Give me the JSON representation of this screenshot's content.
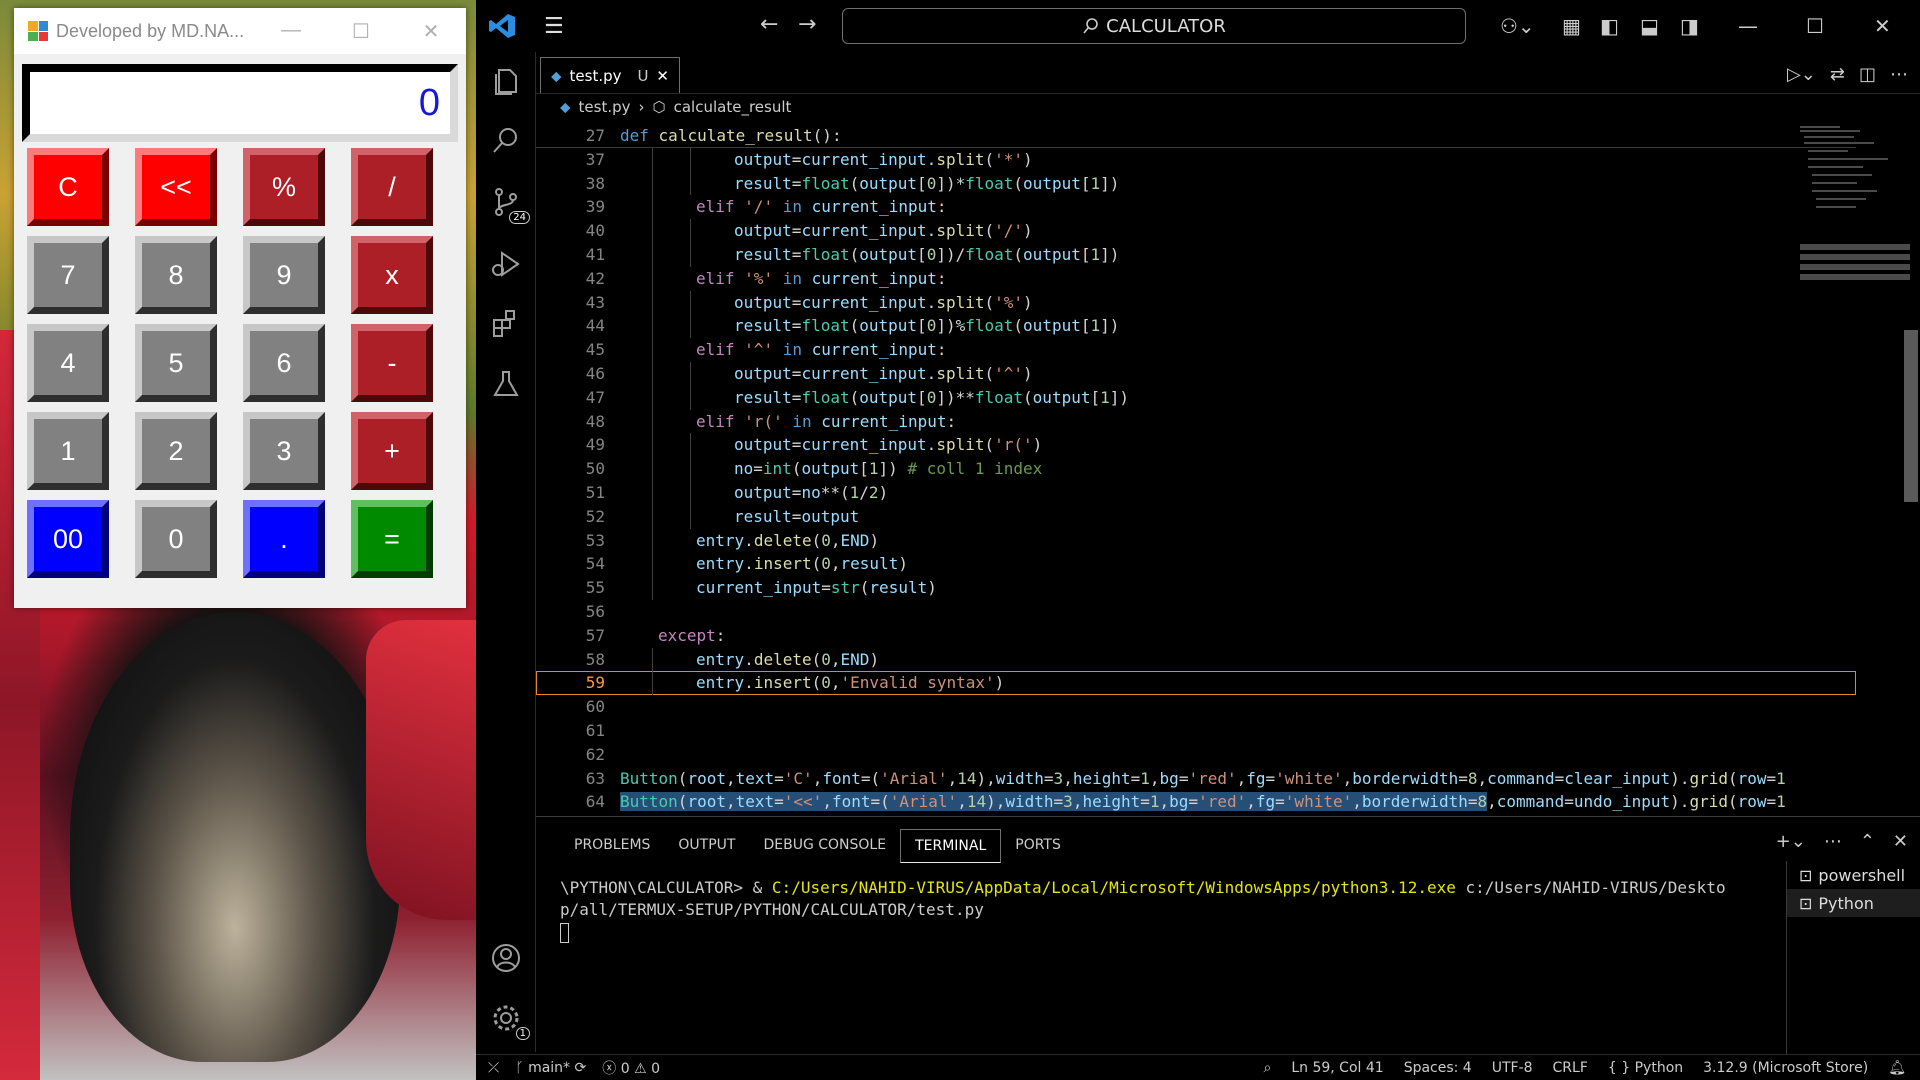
{
  "calculator": {
    "title": "Developed by MD.NA...",
    "display_value": "0",
    "buttons": [
      {
        "label": "C",
        "style": "red"
      },
      {
        "label": "<<",
        "style": "red"
      },
      {
        "label": "%",
        "style": "dred"
      },
      {
        "label": "/",
        "style": "dred"
      },
      {
        "label": "7",
        "style": "gray"
      },
      {
        "label": "8",
        "style": "gray"
      },
      {
        "label": "9",
        "style": "gray"
      },
      {
        "label": "x",
        "style": "dred"
      },
      {
        "label": "4",
        "style": "gray"
      },
      {
        "label": "5",
        "style": "gray"
      },
      {
        "label": "6",
        "style": "gray"
      },
      {
        "label": "-",
        "style": "dred"
      },
      {
        "label": "1",
        "style": "gray"
      },
      {
        "label": "2",
        "style": "gray"
      },
      {
        "label": "3",
        "style": "gray"
      },
      {
        "label": "+",
        "style": "dred"
      },
      {
        "label": "00",
        "style": "blue"
      },
      {
        "label": "0",
        "style": "gray"
      },
      {
        "label": ".",
        "style": "blue"
      },
      {
        "label": "=",
        "style": "green"
      }
    ]
  },
  "vscode": {
    "search_text": "CALCULATOR",
    "source_control_badge": "24",
    "settings_badge": "1",
    "tab": {
      "label": "test.py",
      "status": "U"
    },
    "breadcrumb": {
      "file": "test.py",
      "symbol": "calculate_result"
    },
    "code_lines": [
      {
        "n": "27",
        "html": "<span class=\"kd\">def</span> <span class=\"f\">calculate_result</span>():",
        "indent": 0,
        "sticky": true
      },
      {
        "n": "37",
        "html": "<span class=\"v\">output</span>=<span class=\"v\">current_input</span>.<span class=\"f\">split</span>(<span class=\"s\">'*'</span>)",
        "indent": 3
      },
      {
        "n": "38",
        "html": "<span class=\"v\">result</span>=<span class=\"b\">float</span>(<span class=\"v\">output</span>[<span class=\"n\">0</span>])*<span class=\"b\">float</span>(<span class=\"v\">output</span>[<span class=\"n\">1</span>])",
        "indent": 3
      },
      {
        "n": "39",
        "html": "<span class=\"k\">elif</span> <span class=\"s\">'/'</span> <span class=\"kd\">in</span> <span class=\"v\">current_input</span>:",
        "indent": 2
      },
      {
        "n": "40",
        "html": "<span class=\"v\">output</span>=<span class=\"v\">current_input</span>.<span class=\"f\">split</span>(<span class=\"s\">'/'</span>)",
        "indent": 3
      },
      {
        "n": "41",
        "html": "<span class=\"v\">result</span>=<span class=\"b\">float</span>(<span class=\"v\">output</span>[<span class=\"n\">0</span>])/<span class=\"b\">float</span>(<span class=\"v\">output</span>[<span class=\"n\">1</span>])",
        "indent": 3
      },
      {
        "n": "42",
        "html": "<span class=\"k\">elif</span> <span class=\"s\">'%'</span> <span class=\"kd\">in</span> <span class=\"v\">current_input</span>:",
        "indent": 2
      },
      {
        "n": "43",
        "html": "<span class=\"v\">output</span>=<span class=\"v\">current_input</span>.<span class=\"f\">split</span>(<span class=\"s\">'%'</span>)",
        "indent": 3
      },
      {
        "n": "44",
        "html": "<span class=\"v\">result</span>=<span class=\"b\">float</span>(<span class=\"v\">output</span>[<span class=\"n\">0</span>])%<span class=\"b\">float</span>(<span class=\"v\">output</span>[<span class=\"n\">1</span>])",
        "indent": 3
      },
      {
        "n": "45",
        "html": "<span class=\"k\">elif</span> <span class=\"s\">'^'</span> <span class=\"kd\">in</span> <span class=\"v\">current_input</span>:",
        "indent": 2
      },
      {
        "n": "46",
        "html": "<span class=\"v\">output</span>=<span class=\"v\">current_input</span>.<span class=\"f\">split</span>(<span class=\"s\">'^'</span>)",
        "indent": 3
      },
      {
        "n": "47",
        "html": "<span class=\"v\">result</span>=<span class=\"b\">float</span>(<span class=\"v\">output</span>[<span class=\"n\">0</span>])**<span class=\"b\">float</span>(<span class=\"v\">output</span>[<span class=\"n\">1</span>])",
        "indent": 3
      },
      {
        "n": "48",
        "html": "<span class=\"k\">elif</span> <span class=\"s\">'r('</span> <span class=\"kd\">in</span> <span class=\"v\">current_input</span>:",
        "indent": 2
      },
      {
        "n": "49",
        "html": "<span class=\"v\">output</span>=<span class=\"v\">current_input</span>.<span class=\"f\">split</span>(<span class=\"s\">'r('</span>)",
        "indent": 3
      },
      {
        "n": "50",
        "html": "<span class=\"v\">no</span>=<span class=\"b\">int</span>(<span class=\"v\">output</span>[<span class=\"n\">1</span>]) <span class=\"c\"># coll 1 index</span>",
        "indent": 3
      },
      {
        "n": "51",
        "html": "<span class=\"v\">output</span>=<span class=\"v\">no</span>**(<span class=\"n\">1</span>/<span class=\"n\">2</span>)",
        "indent": 3
      },
      {
        "n": "52",
        "html": "<span class=\"v\">result</span>=<span class=\"v\">output</span>",
        "indent": 3
      },
      {
        "n": "53",
        "html": "<span class=\"v\">entry</span>.<span class=\"f\">delete</span>(<span class=\"n\">0</span>,<span class=\"v\">END</span>)",
        "indent": 2
      },
      {
        "n": "54",
        "html": "<span class=\"v\">entry</span>.<span class=\"f\">insert</span>(<span class=\"n\">0</span>,<span class=\"v\">result</span>)",
        "indent": 2
      },
      {
        "n": "55",
        "html": "<span class=\"v\">current_input</span>=<span class=\"b\">str</span>(<span class=\"v\">result</span>)",
        "indent": 2
      },
      {
        "n": "56",
        "html": "",
        "indent": 0
      },
      {
        "n": "57",
        "html": "<span class=\"k\">except</span>:",
        "indent": 1
      },
      {
        "n": "58",
        "html": "<span class=\"v\">entry</span>.<span class=\"f\">delete</span>(<span class=\"n\">0</span>,<span class=\"v\">END</span>)",
        "indent": 2
      },
      {
        "n": "59",
        "html": "<span class=\"v\">entry</span>.<span class=\"f\">insert</span>(<span class=\"n\">0</span>,<span class=\"s\">'Envalid syntax'</span>)",
        "indent": 2,
        "current": true
      },
      {
        "n": "60",
        "html": "",
        "indent": 0
      },
      {
        "n": "61",
        "html": "",
        "indent": 0
      },
      {
        "n": "62",
        "html": "",
        "indent": 0
      },
      {
        "n": "63",
        "html": "<span class=\"b\">Button</span>(<span class=\"v\">root</span>,<span class=\"v\">text</span>=<span class=\"s\">'C'</span>,<span class=\"v\">font</span>=(<span class=\"s\">'Arial'</span>,<span class=\"n\">14</span>),<span class=\"v\">width</span>=<span class=\"n\">3</span>,<span class=\"v\">height</span>=<span class=\"n\">1</span>,<span class=\"v\">bg</span>=<span class=\"s\">'red'</span>,<span class=\"v\">fg</span>=<span class=\"s\">'white'</span>,<span class=\"v\">borderwidth</span>=<span class=\"n\">8</span>,<span class=\"v\">command</span>=<span class=\"v\">clear_input</span>).<span class=\"f\">grid</span>(<span class=\"v\">row</span>=<span class=\"n\">1</span>",
        "indent": 0
      },
      {
        "n": "64",
        "html": "<span class=\"sel\"><span class=\"b\">Button</span>(<span class=\"v\">root</span>,<span class=\"v\">text</span>=<span class=\"s\">'&lt;&lt;'</span>,<span class=\"v\">font</span>=(<span class=\"s\">'Arial'</span>,<span class=\"n\">14</span>),<span class=\"v\">width</span>=<span class=\"n\">3</span>,<span class=\"v\">height</span>=<span class=\"n\">1</span>,<span class=\"v\">bg</span>=<span class=\"s\">'red'</span>,<span class=\"v\">fg</span>=<span class=\"s\">'white'</span>,<span class=\"v\">borderwidth</span>=<span class=\"n\">8</span></span>,<span class=\"v\">command</span>=<span class=\"v\">undo_input</span>).<span class=\"f\">grid</span>(<span class=\"v\">row</span>=<span class=\"n\">1</span>",
        "indent": 0
      }
    ],
    "panel_tabs": [
      "PROBLEMS",
      "OUTPUT",
      "DEBUG CONSOLE",
      "TERMINAL",
      "PORTS"
    ],
    "active_panel_tab": "TERMINAL",
    "terminal": {
      "prompt": "\\PYTHON\\CALCULATOR> & ",
      "exe": "C:/Users/NAHID-VIRUS/AppData/Local/Microsoft/WindowsApps/python3.12.exe",
      "args": " c:/Users/NAHID-VIRUS/Desktop/all/TERMUX-SETUP/PYTHON/CALCULATOR/test.py"
    },
    "terminals": [
      "powershell",
      "Python"
    ],
    "status": {
      "branch": "main*",
      "errors": "0",
      "warnings": "0",
      "position": "Ln 59, Col 41",
      "spaces": "Spaces: 4",
      "encoding": "UTF-8",
      "eol": "CRLF",
      "language": "Python",
      "interpreter": "3.12.9 (Microsoft Store)"
    }
  }
}
